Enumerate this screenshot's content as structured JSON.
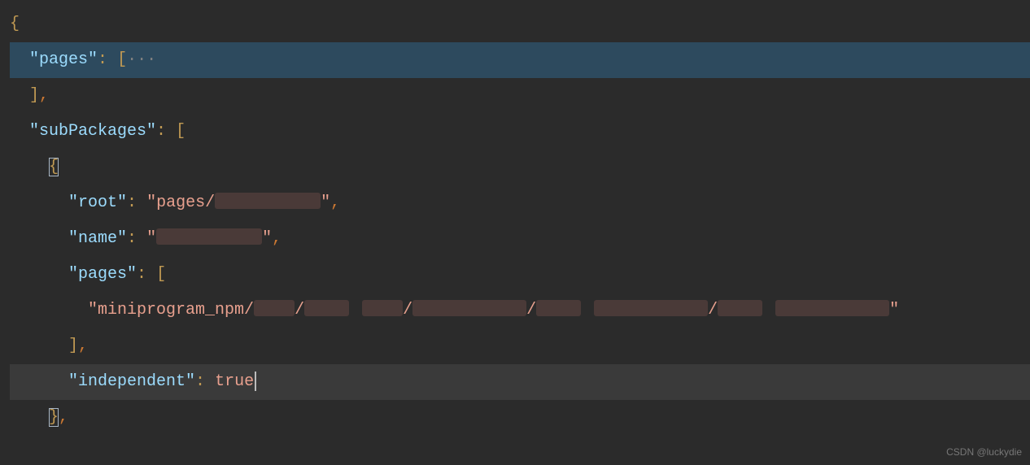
{
  "code": {
    "line1": "{",
    "line2_key": "\"pages\"",
    "line2_colon": ":",
    "line2_bracket": "[",
    "line2_fold": "···",
    "line3": "],",
    "line4_key": "\"subPackages\"",
    "line4_colon": ":",
    "line4_bracket": "[",
    "line5": "{",
    "line6_key": "\"root\"",
    "line6_colon": ":",
    "line6_str_open": "\"pages/",
    "line6_str_close": "\"",
    "line6_comma": ",",
    "line7_key": "\"name\"",
    "line7_colon": ":",
    "line7_str_open": "\"",
    "line7_str_close": "\"",
    "line7_comma": ",",
    "line8_key": "\"pages\"",
    "line8_colon": ":",
    "line8_bracket": "[",
    "line9_str_open": "\"miniprogram_npm/",
    "line9_slash": "/",
    "line9_str_close": "\"",
    "line10": "],",
    "line11_key": "\"independent\"",
    "line11_colon": ":",
    "line11_val": "true",
    "line12": "},"
  },
  "watermark": "CSDN @luckydie"
}
